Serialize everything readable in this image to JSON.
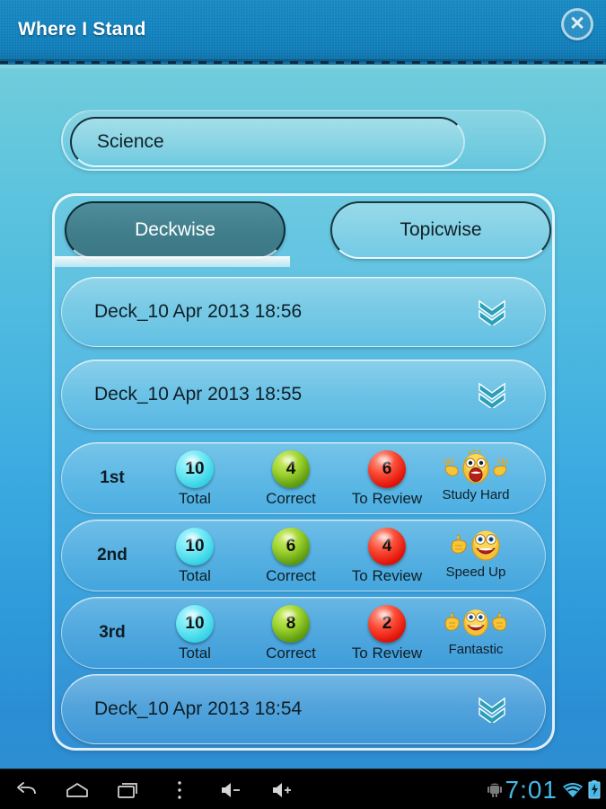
{
  "titlebar": {
    "title": "Where I Stand",
    "close_icon": "close-circle-icon"
  },
  "subject": {
    "value": "Science"
  },
  "tabs": [
    {
      "label": "Deckwise",
      "active": true
    },
    {
      "label": "Topicwise",
      "active": false
    }
  ],
  "list": {
    "rows": [
      {
        "type": "deck",
        "label": "Deck_10 Apr 2013 18:56",
        "expand_icon": "chevron-double-down-icon"
      },
      {
        "type": "deck",
        "label": "Deck_10 Apr 2013 18:55",
        "expand_icon": "chevron-double-down-icon"
      },
      {
        "type": "score",
        "rank": "1st",
        "total": "10",
        "total_label": "Total",
        "correct": "4",
        "correct_label": "Correct",
        "review": "6",
        "review_label": "To Review",
        "mood": "Study Hard",
        "mood_icon": "face-shouting-icon"
      },
      {
        "type": "score",
        "rank": "2nd",
        "total": "10",
        "total_label": "Total",
        "correct": "6",
        "correct_label": "Correct",
        "review": "4",
        "review_label": "To Review",
        "mood": "Speed Up",
        "mood_icon": "face-thumbs-up-icon"
      },
      {
        "type": "score",
        "rank": "3rd",
        "total": "10",
        "total_label": "Total",
        "correct": "8",
        "correct_label": "Correct",
        "review": "2",
        "review_label": "To Review",
        "mood": "Fantastic",
        "mood_icon": "face-two-thumbs-up-icon"
      },
      {
        "type": "deck",
        "label": "Deck_10 Apr 2013 18:54",
        "expand_icon": "chevron-double-down-icon"
      }
    ]
  },
  "navbar": {
    "back_icon": "back-arrow-icon",
    "home_icon": "home-icon",
    "recents_icon": "recent-apps-icon",
    "menu_icon": "overflow-menu-icon",
    "volume_down_icon": "volume-down-icon",
    "volume_up_icon": "volume-up-icon",
    "android_icon": "android-robot-icon",
    "clock": "7:01",
    "wifi_icon": "wifi-icon",
    "battery_icon": "battery-charging-icon"
  },
  "colors": {
    "accent_blue": "#1486c2",
    "badge_total": "#37d3e6",
    "badge_correct": "#5f9d10",
    "badge_review": "#e01409",
    "clock_blue": "#46b9e8",
    "tab_active_bg": "#407e8c"
  }
}
